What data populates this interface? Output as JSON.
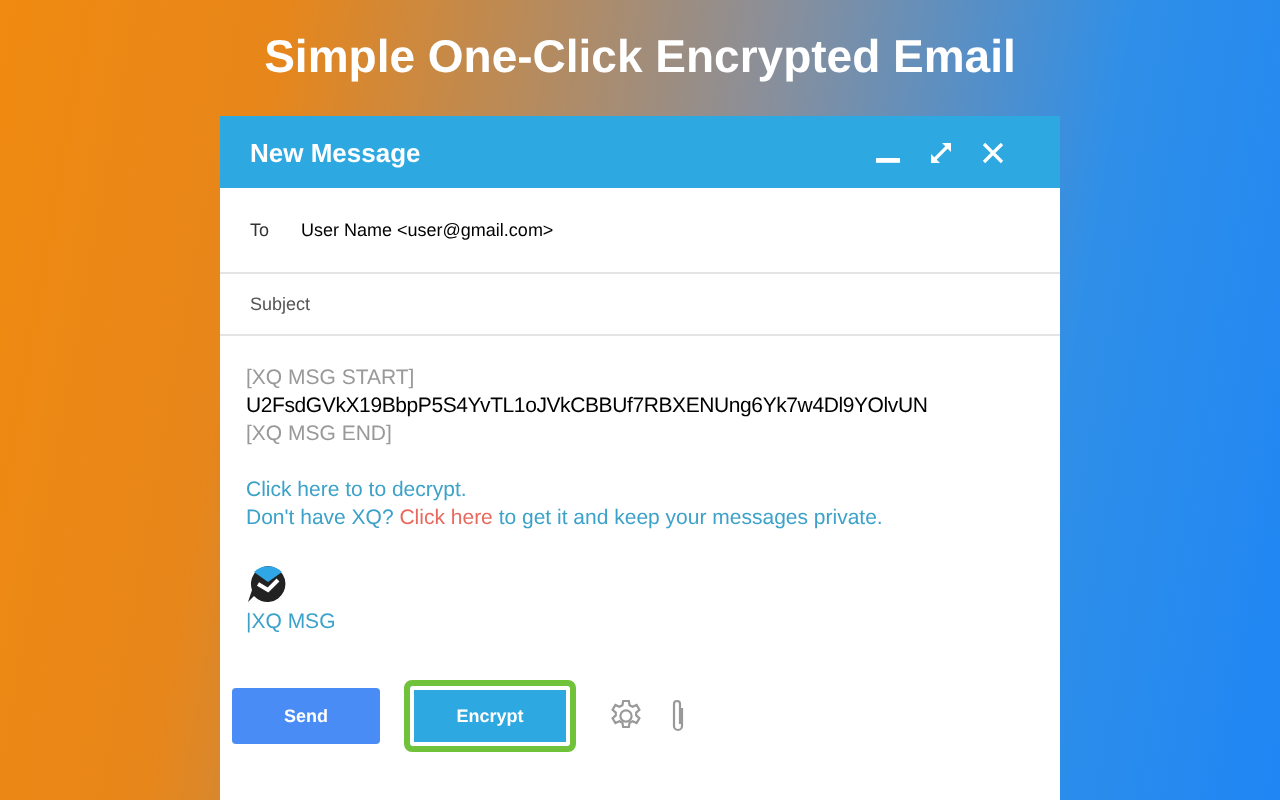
{
  "headline": "Simple One-Click Encrypted Email",
  "window": {
    "title": "New Message"
  },
  "to": {
    "label": "To",
    "value": "User Name <user@gmail.com>"
  },
  "subject": {
    "placeholder": "Subject"
  },
  "body": [
    {
      "kind": "marker",
      "text": "[XQ MSG START]"
    },
    {
      "kind": "code",
      "text": "U2FsdGVkX19BbpP5S4YvTL1oJVkCBBUf7RBXENUng6Yk7w4Dl9YOlvUN"
    },
    {
      "kind": "marker",
      "text": "[XQ MSG END]"
    }
  ],
  "links": [
    {
      "parts": [
        {
          "kind": "text",
          "text": "Click here to to decrypt."
        }
      ]
    },
    {
      "parts": [
        {
          "kind": "text",
          "text": "Don't have XQ? "
        },
        {
          "kind": "link",
          "text": "Click here"
        },
        {
          "kind": "text",
          "text": " to get it and keep your messages private."
        }
      ]
    }
  ],
  "signature": "|XQ MSG",
  "buttons": [
    {
      "kind": "send",
      "label": "Send",
      "highlighted": false
    },
    {
      "kind": "encrypt",
      "label": "Encrypt",
      "highlighted": true
    }
  ]
}
